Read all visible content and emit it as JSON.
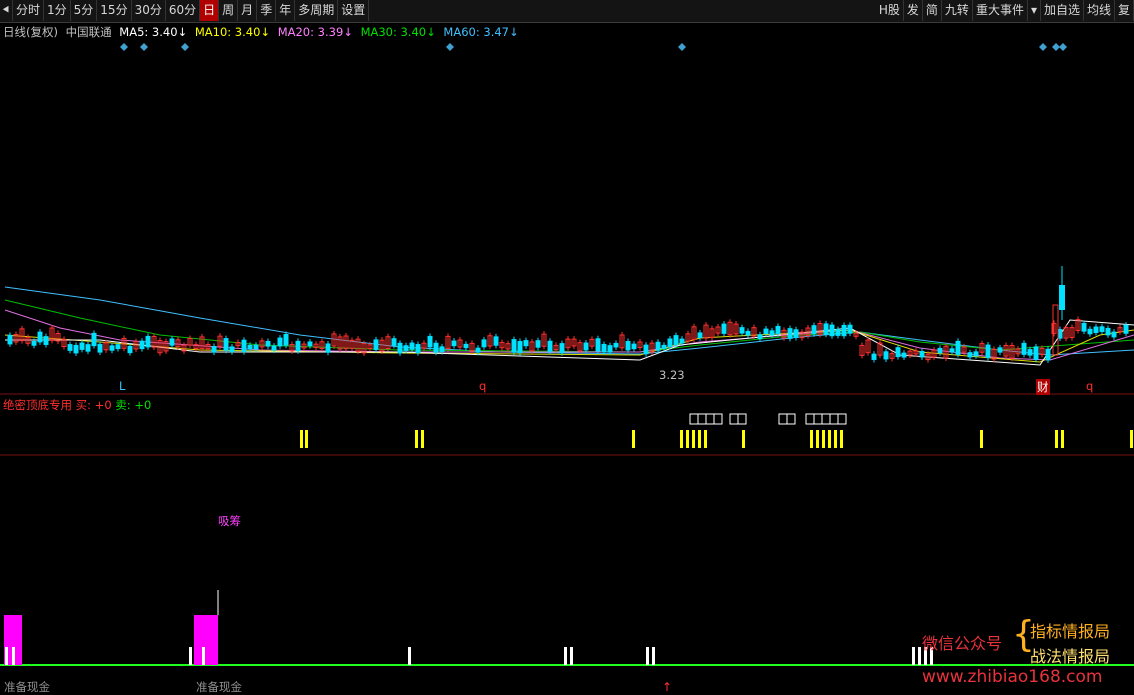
{
  "toolbar": {
    "left": [
      "分时",
      "1分",
      "5分",
      "15分",
      "30分",
      "60分",
      "日",
      "周",
      "月",
      "季",
      "年",
      "多周期",
      "设置"
    ],
    "active": "日",
    "right": [
      "H股",
      "发",
      "简",
      "九转",
      "重大事件",
      "加自选",
      "均线",
      "复"
    ]
  },
  "info": {
    "chart_type": "日线(复权)",
    "stock": "中国联通",
    "ma": [
      {
        "label": "MA5: 3.40↓",
        "color": "#ffffff"
      },
      {
        "label": "MA10: 3.40↓",
        "color": "#ffff00"
      },
      {
        "label": "MA20: 3.39↓",
        "color": "#ff80ff"
      },
      {
        "label": "MA30: 3.40↓",
        "color": "#00e000"
      },
      {
        "label": "MA60: 3.47↓",
        "color": "#40c0ff"
      }
    ]
  },
  "annotations": {
    "L": "L",
    "q1": "q",
    "low_price": "3.23",
    "cai": "财",
    "q2": "q"
  },
  "indicator1": {
    "name": "绝密顶底专用",
    "buy": "买: +0",
    "sell": "卖: +0"
  },
  "indicator2": {
    "xichou": "吸筹",
    "zhunbei1": "准备现金",
    "zhunbei2": "准备现金"
  },
  "watermark": {
    "wechat": "微信公众号",
    "name1": "指标情报局",
    "name2": "战法情报局",
    "url": "www.zhibiao168.com"
  },
  "colors": {
    "up": "#ff3030",
    "down": "#00e0ff",
    "signal": "#ffff00",
    "bar_magenta": "#ff00ff",
    "baseline": "#20ff20"
  }
}
